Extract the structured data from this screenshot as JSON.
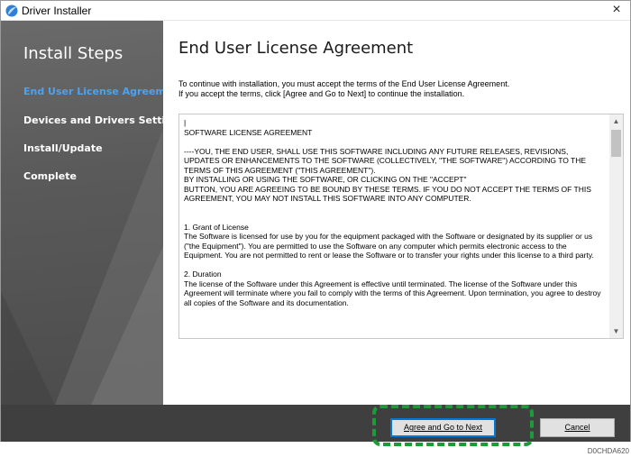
{
  "window": {
    "title": "Driver Installer",
    "close_glyph": "×"
  },
  "sidebar": {
    "title": "Install Steps",
    "steps": [
      {
        "label": "End User License Agreement",
        "active": true
      },
      {
        "label": "Devices and Drivers Settings",
        "active": false
      },
      {
        "label": "Install/Update",
        "active": false
      },
      {
        "label": "Complete",
        "active": false
      }
    ]
  },
  "main": {
    "heading": "End User License Agreement",
    "intro_line1": "To continue with installation, you must accept the terms of the End User License Agreement.",
    "intro_line2": "If you accept the terms, click [Agree and Go to Next] to continue the installation.",
    "license_text": "|\nSOFTWARE LICENSE AGREEMENT\n\n----YOU, THE END USER, SHALL USE THIS SOFTWARE INCLUDING ANY FUTURE RELEASES, REVISIONS, UPDATES OR ENHANCEMENTS TO THE SOFTWARE (COLLECTIVELY, \"THE SOFTWARE\") ACCORDING TO THE TERMS OF THIS AGREEMENT (\"THIS AGREEMENT\").\nBY INSTALLING OR USING THE SOFTWARE, OR CLICKING ON THE \"ACCEPT\"\nBUTTON, YOU ARE AGREEING TO BE BOUND BY THESE TERMS. IF YOU DO NOT ACCEPT THE TERMS OF THIS AGREEMENT, YOU MAY NOT INSTALL THIS SOFTWARE INTO ANY COMPUTER.\n\n\n1. Grant of License\nThe Software is licensed for use by you for the equipment packaged with the Software or designated by its supplier or us (\"the Equipment\"). You are permitted to use the Software on any computer which permits electronic access to the Equipment. You are not permitted to rent or lease the Software or to transfer your rights under this license to a third party.\n\n2. Duration\nThe license of the Software under this Agreement is effective until terminated. The license of the Software under this Agreement will terminate where you fail to comply with the terms of this Agreement. Upon termination, you agree to destroy all copies of the Software and its documentation."
  },
  "footer": {
    "agree_label": "Agree and Go to Next",
    "cancel_label": "Cancel"
  },
  "figure_code": "D0CHDA620",
  "colors": {
    "sidebar_bg": "#5a5a5a",
    "active_step": "#4aa3f2",
    "footer_bg": "#3f3f3f",
    "highlight": "#1f9a3a"
  }
}
